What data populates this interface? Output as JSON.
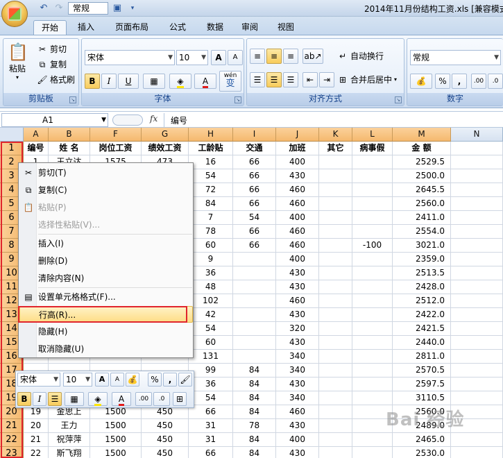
{
  "app": {
    "title": "2014年11月份结构工资.xls  [兼容模式",
    "qat_font": "常规"
  },
  "tabs": [
    {
      "label": "开始",
      "active": true
    },
    {
      "label": "插入"
    },
    {
      "label": "页面布局"
    },
    {
      "label": "公式"
    },
    {
      "label": "数据"
    },
    {
      "label": "审阅"
    },
    {
      "label": "视图"
    }
  ],
  "ribbon": {
    "clipboard": {
      "label": "剪贴板",
      "paste": "粘贴",
      "cut": "剪切",
      "copy": "复制",
      "format_painter": "格式刷"
    },
    "font": {
      "label": "字体",
      "font_name": "宋体",
      "font_size": "10",
      "bold": "B",
      "italic": "I",
      "underline": "U",
      "grow": "A",
      "shrink": "A",
      "color_letter": "A",
      "wen": "wén",
      "wen_char": "变"
    },
    "alignment": {
      "label": "对齐方式",
      "wrap": "自动换行",
      "merge": "合并后居中"
    },
    "number": {
      "label": "数字",
      "format": "常规",
      "percent": "%",
      "comma": ","
    }
  },
  "formula_bar": {
    "cell_ref": "A1",
    "fx": "fx",
    "value": "编号"
  },
  "columns": [
    "A",
    "B",
    "F",
    "G",
    "H",
    "I",
    "J",
    "K",
    "L",
    "M",
    "N"
  ],
  "header_row": [
    "编号",
    "姓 名",
    "岗位工资",
    "绩效工资",
    "工龄贴",
    "交通",
    "加班",
    "其它",
    "病事假",
    "金 额"
  ],
  "rows": [
    {
      "n": "1",
      "cells": [
        "1",
        "王立达",
        "1575",
        "473",
        "16",
        "66",
        "400",
        "",
        "",
        "2529.5"
      ]
    },
    {
      "n": "2",
      "cells": [
        "",
        "",
        "",
        "",
        "54",
        "66",
        "430",
        "",
        "",
        "2500.0"
      ]
    },
    {
      "n": "3",
      "cells": [
        "",
        "",
        "",
        "",
        "72",
        "66",
        "460",
        "",
        "",
        "2645.5"
      ]
    },
    {
      "n": "4",
      "cells": [
        "",
        "",
        "",
        "",
        "84",
        "66",
        "460",
        "",
        "",
        "2560.0"
      ]
    },
    {
      "n": "5",
      "cells": [
        "",
        "",
        "",
        "",
        "7",
        "54",
        "400",
        "",
        "",
        "2411.0"
      ]
    },
    {
      "n": "6",
      "cells": [
        "",
        "",
        "",
        "",
        "78",
        "66",
        "460",
        "",
        "",
        "2554.0"
      ]
    },
    {
      "n": "7",
      "cells": [
        "",
        "",
        "",
        "",
        "60",
        "66",
        "460",
        "",
        "-100",
        "3021.0"
      ]
    },
    {
      "n": "8",
      "cells": [
        "",
        "",
        "",
        "",
        "9",
        "",
        "400",
        "",
        "",
        "2359.0"
      ]
    },
    {
      "n": "9",
      "cells": [
        "",
        "",
        "",
        "",
        "36",
        "",
        "430",
        "",
        "",
        "2513.5"
      ]
    },
    {
      "n": "10",
      "cells": [
        "",
        "",
        "",
        "",
        "48",
        "",
        "430",
        "",
        "",
        "2428.0"
      ]
    },
    {
      "n": "11",
      "cells": [
        "",
        "",
        "",
        "",
        "102",
        "",
        "460",
        "",
        "",
        "2512.0"
      ]
    },
    {
      "n": "12",
      "cells": [
        "",
        "",
        "",
        "",
        "42",
        "",
        "430",
        "",
        "",
        "2422.0"
      ]
    },
    {
      "n": "13",
      "cells": [
        "",
        "",
        "",
        "",
        "54",
        "",
        "320",
        "",
        "",
        "2421.5"
      ]
    },
    {
      "n": "14",
      "cells": [
        "",
        "",
        "",
        "",
        "60",
        "",
        "430",
        "",
        "",
        "2440.0"
      ]
    },
    {
      "n": "15",
      "cells": [
        "",
        "",
        "",
        "",
        "131",
        "",
        "340",
        "",
        "",
        "2811.0"
      ]
    },
    {
      "n": "16",
      "cells": [
        "",
        "",
        "",
        "",
        "99",
        "84",
        "340",
        "",
        "",
        "2570.5"
      ]
    },
    {
      "n": "17",
      "cells": [
        "",
        "",
        "",
        "",
        "36",
        "84",
        "430",
        "",
        "",
        "2597.5"
      ]
    },
    {
      "n": "18",
      "cells": [
        "",
        "",
        "",
        "",
        "54",
        "84",
        "340",
        "",
        "",
        "3110.5"
      ]
    },
    {
      "n": "19",
      "cells": [
        "19",
        "金思上",
        "1500",
        "450",
        "66",
        "84",
        "460",
        "",
        "",
        "2560.0"
      ]
    },
    {
      "n": "20",
      "cells": [
        "20",
        "王力",
        "1500",
        "450",
        "31",
        "78",
        "430",
        "",
        "",
        "2489.0"
      ]
    },
    {
      "n": "21",
      "cells": [
        "21",
        "祝萍萍",
        "1500",
        "450",
        "31",
        "84",
        "400",
        "",
        "",
        "2465.0"
      ]
    },
    {
      "n": "22",
      "cells": [
        "22",
        "斯飞翔",
        "1500",
        "450",
        "66",
        "84",
        "430",
        "",
        "",
        "2530.0"
      ]
    }
  ],
  "row_numbers": [
    "1",
    "2",
    "3",
    "4",
    "5",
    "6",
    "7",
    "8",
    "9",
    "10",
    "11",
    "12",
    "13",
    "14",
    "15",
    "16",
    "17",
    "18",
    "19",
    "20",
    "21",
    "22",
    "23"
  ],
  "context_menu": {
    "items": [
      {
        "label": "剪切(T)",
        "icon": "scissors-icon",
        "disabled": false
      },
      {
        "label": "复制(C)",
        "icon": "copy-icon",
        "disabled": false
      },
      {
        "label": "粘贴(P)",
        "icon": "paste-icon",
        "disabled": true
      },
      {
        "label": "选择性粘贴(V)...",
        "icon": "",
        "disabled": true
      },
      {
        "label": "插入(I)",
        "icon": "",
        "disabled": false
      },
      {
        "label": "删除(D)",
        "icon": "",
        "disabled": false
      },
      {
        "label": "清除内容(N)",
        "icon": "",
        "disabled": false
      },
      {
        "label": "设置单元格格式(F)...",
        "icon": "format-cells-icon",
        "disabled": false
      },
      {
        "label": "行高(R)...",
        "icon": "",
        "disabled": false,
        "highlighted": true
      },
      {
        "label": "隐藏(H)",
        "icon": "",
        "disabled": false
      },
      {
        "label": "取消隐藏(U)",
        "icon": "",
        "disabled": false
      }
    ]
  },
  "mini_toolbar": {
    "font_name": "宋体",
    "font_size": "10",
    "percent": "%",
    "comma": ","
  },
  "watermark": "Bai 经验",
  "colors": {
    "accent_orange": "#f5b96e",
    "highlight": "#fddd86",
    "red_outline": "#e0242c",
    "ribbon_blue": "#15428b"
  }
}
